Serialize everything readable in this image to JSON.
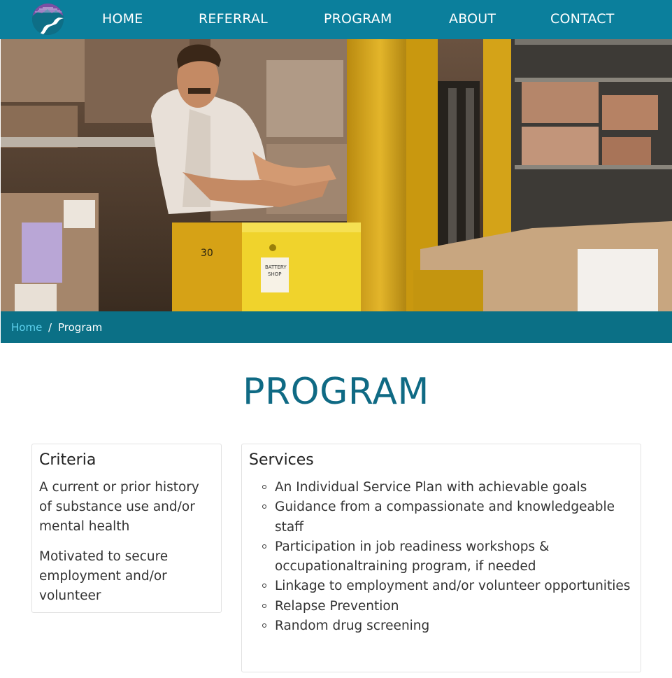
{
  "nav": {
    "logo_icon": "river-mountain-logo-icon",
    "items": [
      {
        "label": "HOME"
      },
      {
        "label": "REFERRAL"
      },
      {
        "label": "PROGRAM"
      },
      {
        "label": "ABOUT"
      },
      {
        "label": "CONTACT"
      }
    ]
  },
  "hero": {
    "image": "warehouse-worker-forklift-photo",
    "battery_label": "BATTERY SHOP",
    "forklift_number": "30"
  },
  "breadcrumb": {
    "home": "Home",
    "separator": "/",
    "current": "Program"
  },
  "page": {
    "title": "PROGRAM"
  },
  "criteria": {
    "title": "Criteria",
    "paragraphs": [
      "A current or prior history of substance use and/or mental health",
      "Motivated to secure employment and/or volunteer"
    ]
  },
  "services": {
    "title": "Services",
    "items": [
      "An Individual Service Plan with achievable goals",
      "Guidance from a compassionate and knowledgeable staff",
      "Participation in job readiness workshops & occupationaltraining program, if needed",
      "Linkage to employment and/or volunteer opportunities",
      "Relapse Prevention",
      "Random drug screening"
    ]
  },
  "colors": {
    "nav_bg": "#0b7f9c",
    "breadcrumb_bg": "#0b7086",
    "title_color": "#0f6a84",
    "link_color": "#5fd3f0"
  }
}
